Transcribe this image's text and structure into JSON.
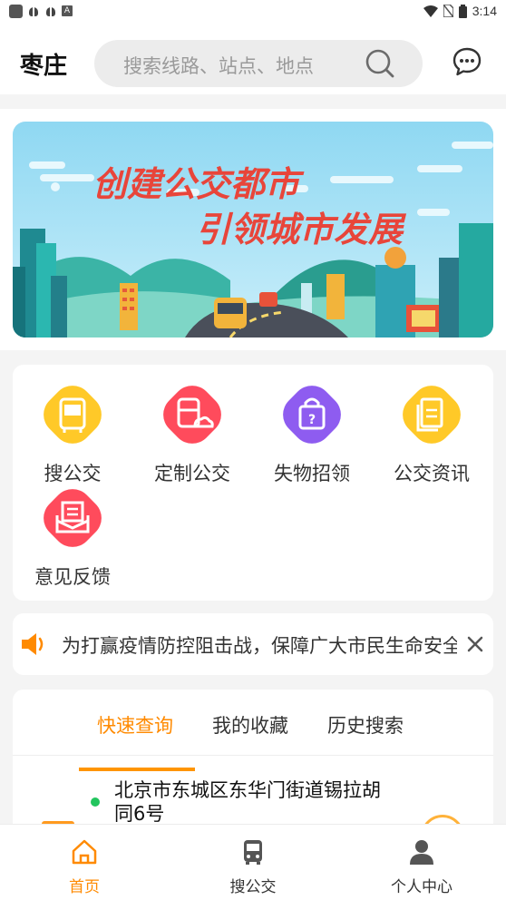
{
  "status_bar": {
    "time": "3:14"
  },
  "header": {
    "city": "枣庄",
    "search_placeholder": "搜索线路、站点、地点"
  },
  "banner": {
    "line1": "创建公交都市",
    "line2": "引领城市发展"
  },
  "menu": {
    "items": [
      {
        "label": "搜公交",
        "color": "#ffc928"
      },
      {
        "label": "定制公交",
        "color": "#ff4b5c"
      },
      {
        "label": "失物招领",
        "color": "#8e5cf0"
      },
      {
        "label": "公交资讯",
        "color": "#ffc928"
      },
      {
        "label": "意见反馈",
        "color": "#ff4b5c"
      }
    ]
  },
  "notice": {
    "text": "为打赢疫情防控阻击战，保障广大市民生命安全"
  },
  "query": {
    "tabs": [
      {
        "label": "快速查询",
        "active": true
      },
      {
        "label": "我的收藏",
        "active": false
      },
      {
        "label": "历史搜索",
        "active": false
      }
    ],
    "location": "北京市东城区东华门街道锡拉胡同6号"
  },
  "bottom_nav": {
    "items": [
      {
        "label": "首页",
        "active": true
      },
      {
        "label": "搜公交",
        "active": false
      },
      {
        "label": "个人中心",
        "active": false
      }
    ]
  },
  "colors": {
    "accent": "#ff8a00",
    "location_dot": "#22c55e"
  }
}
